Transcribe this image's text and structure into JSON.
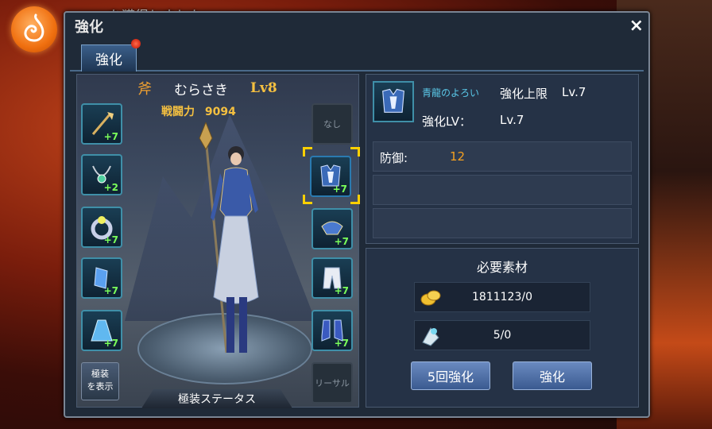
{
  "notice": {
    "text": "を獲得しました"
  },
  "window": {
    "title": "強化",
    "close_icon": "×"
  },
  "tabs": [
    {
      "label": "強化",
      "has_badge": true
    }
  ],
  "character": {
    "name": "むらさき",
    "level": "Lv8",
    "power_label": "戦闘力",
    "power_value": "9094",
    "class_icon": "axe-icon"
  },
  "left_slots": [
    {
      "name": "staff",
      "plus": "+7"
    },
    {
      "name": "necklace",
      "plus": "+2"
    },
    {
      "name": "ring",
      "plus": "+7"
    },
    {
      "name": "bracer",
      "plus": "+7"
    },
    {
      "name": "cape",
      "plus": "+7"
    }
  ],
  "right_slots": [
    {
      "name": "empty-top",
      "label": "なし",
      "plus": ""
    },
    {
      "name": "chest-armor",
      "label": "",
      "plus": "+7",
      "selected": true
    },
    {
      "name": "shoulder",
      "label": "",
      "plus": "+7"
    },
    {
      "name": "pants",
      "label": "",
      "plus": "+7"
    },
    {
      "name": "boots",
      "label": "",
      "plus": "+7"
    },
    {
      "name": "empty-bottom",
      "label": "リーサル",
      "plus": ""
    }
  ],
  "show_button": {
    "line1": "極装",
    "line2": "を表示"
  },
  "status_button": {
    "label": "極装ステータス"
  },
  "item": {
    "name": "青龍のよろい",
    "max_label": "強化上限",
    "max_value": "Lv.7",
    "lv_label": "強化LV：",
    "lv_value": "Lv.7"
  },
  "stats": [
    {
      "name": "防御:",
      "value": "12"
    },
    {
      "name": "",
      "value": ""
    },
    {
      "name": "",
      "value": ""
    }
  ],
  "materials": {
    "title": "必要素材",
    "items": [
      {
        "icon": "gold-coin-icon",
        "value": "1811123/0"
      },
      {
        "icon": "enhance-stone-icon",
        "value": "5/0"
      }
    ]
  },
  "buttons": {
    "five_times": "5回強化",
    "enhance": "強化"
  },
  "colors": {
    "accent_gold": "#f5c040",
    "stat_value": "#f5a020",
    "item_name": "#5ac8e8",
    "selected_frame": "#ffd000"
  }
}
